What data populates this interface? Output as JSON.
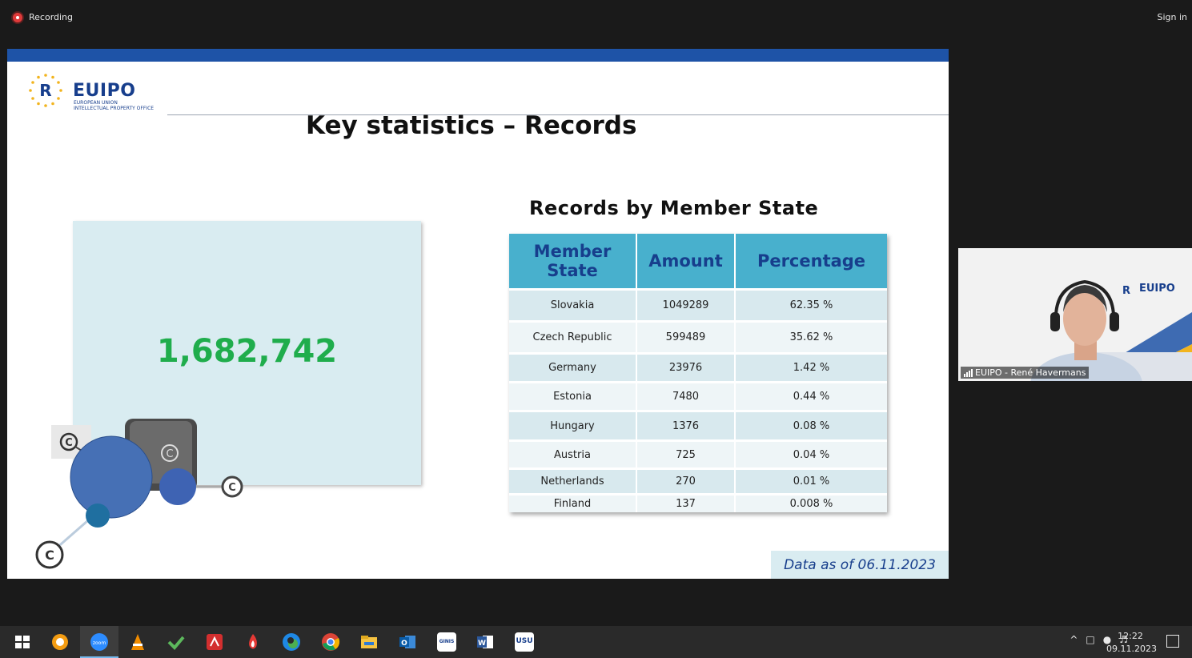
{
  "zoom": {
    "recording_label": "Recording",
    "sign_in_label": "Sign in"
  },
  "slide": {
    "logo": {
      "word": "EUIPO",
      "sub1": "EUROPEAN UNION",
      "sub2": "INTELLECTUAL PROPERTY OFFICE"
    },
    "title": "Key statistics – Records",
    "total_records": "1,682,742",
    "table_title": "Records by Member State",
    "table": {
      "headers": [
        "Member State",
        "Amount",
        "Percentage"
      ],
      "rows": [
        [
          "Slovakia",
          "1049289",
          "62.35 %"
        ],
        [
          "Czech Republic",
          "599489",
          "35.62 %"
        ],
        [
          "Germany",
          "23976",
          "1.42 %"
        ],
        [
          "Estonia",
          "7480",
          "0.44 %"
        ],
        [
          "Hungary",
          "1376",
          "0.08 %"
        ],
        [
          "Austria",
          "725",
          "0.04 %"
        ],
        [
          "Netherlands",
          "270",
          "0.01 %"
        ],
        [
          "Finland",
          "137",
          "0.008 %"
        ]
      ]
    },
    "data_as_of": "Data as of 06.11.2023"
  },
  "video_tile": {
    "participant_name": "EUIPO - René Havermans",
    "logo_word": "EUIPO"
  },
  "taskbar": {
    "apps": [
      "start",
      "app-sun",
      "zoom",
      "vlc",
      "checkmark-app",
      "acrobat",
      "flame-app",
      "edge",
      "chrome",
      "file-explorer",
      "outlook",
      "ginis",
      "word",
      "usu"
    ],
    "ginis_label": "GINIS",
    "usu_label": "USU",
    "zoom_label": "zoom",
    "clock_time": "12:22",
    "clock_date": "09.11.2023"
  },
  "colors": {
    "accent_blue": "#1e53a7",
    "header_teal": "#48b0cd",
    "number_green": "#1fad4c",
    "dark_blue_text": "#173e8c"
  }
}
